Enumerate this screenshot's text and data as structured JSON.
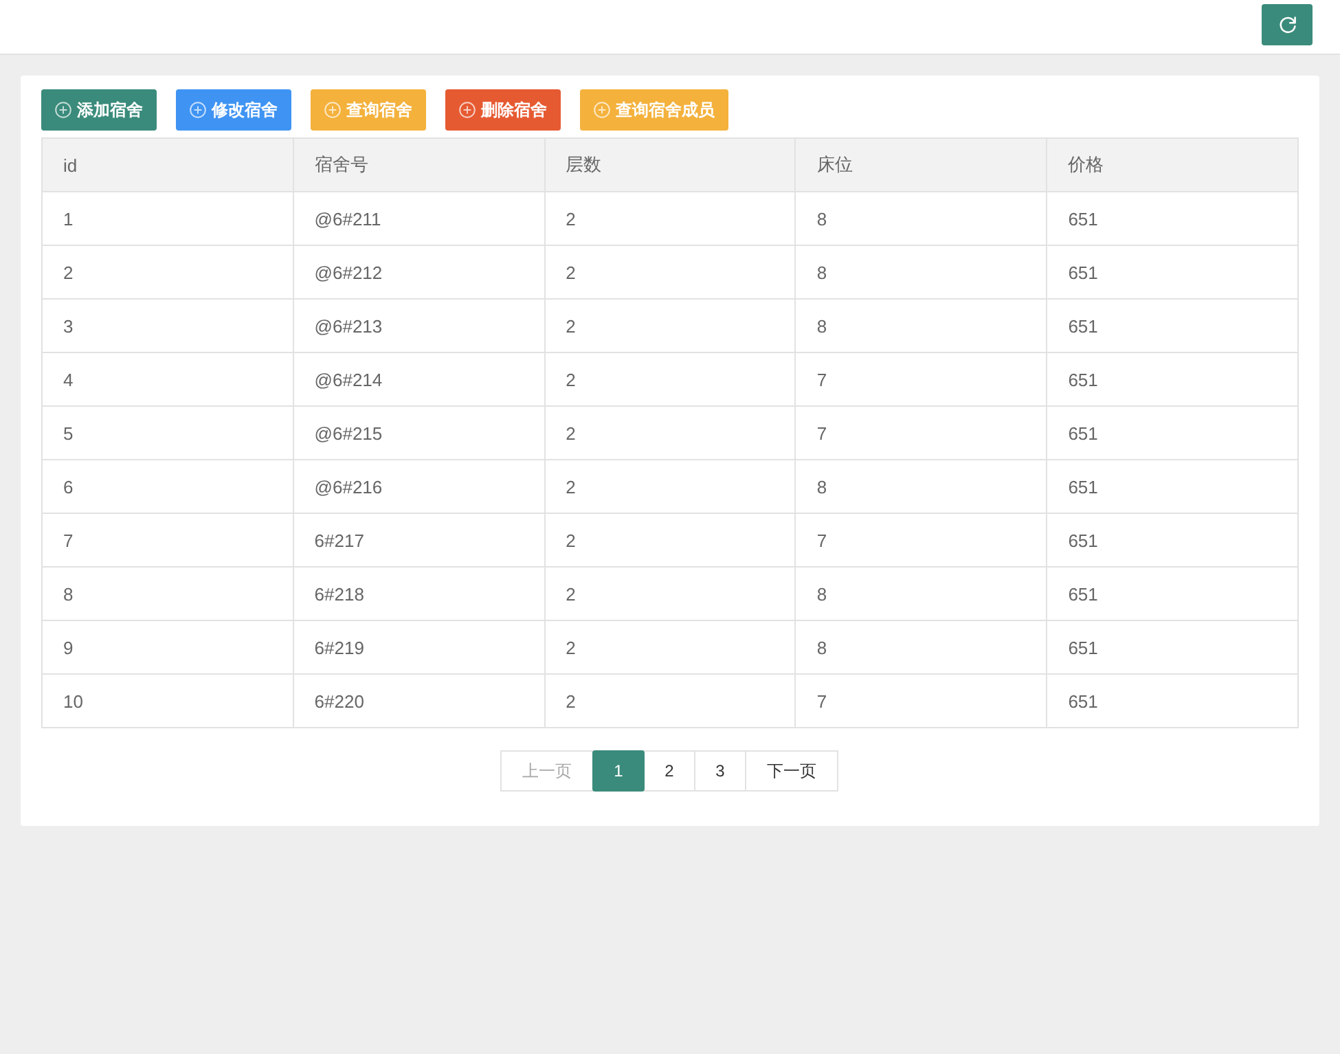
{
  "toolbar": {
    "buttons": [
      {
        "label": "添加宿舍",
        "color": "#3a8b7b"
      },
      {
        "label": "修改宿舍",
        "color": "#3f94f3"
      },
      {
        "label": "查询宿舍",
        "color": "#f4b13c"
      },
      {
        "label": "删除宿舍",
        "color": "#e65a32"
      },
      {
        "label": "查询宿舍成员",
        "color": "#f4b13c"
      }
    ]
  },
  "table": {
    "columns": [
      "id",
      "宿舍号",
      "层数",
      "床位",
      "价格"
    ],
    "rows": [
      [
        "1",
        "@6#211",
        "2",
        "8",
        "651"
      ],
      [
        "2",
        "@6#212",
        "2",
        "8",
        "651"
      ],
      [
        "3",
        "@6#213",
        "2",
        "8",
        "651"
      ],
      [
        "4",
        "@6#214",
        "2",
        "7",
        "651"
      ],
      [
        "5",
        "@6#215",
        "2",
        "7",
        "651"
      ],
      [
        "6",
        "@6#216",
        "2",
        "8",
        "651"
      ],
      [
        "7",
        "6#217",
        "2",
        "7",
        "651"
      ],
      [
        "8",
        "6#218",
        "2",
        "8",
        "651"
      ],
      [
        "9",
        "6#219",
        "2",
        "8",
        "651"
      ],
      [
        "10",
        "6#220",
        "2",
        "7",
        "651"
      ]
    ]
  },
  "pagination": {
    "prev": {
      "label": "上一页",
      "disabled": true
    },
    "pages": [
      {
        "label": "1",
        "selected": true
      },
      {
        "label": "2",
        "selected": false
      },
      {
        "label": "3",
        "selected": false
      }
    ],
    "next": {
      "label": "下一页",
      "disabled": false
    }
  }
}
